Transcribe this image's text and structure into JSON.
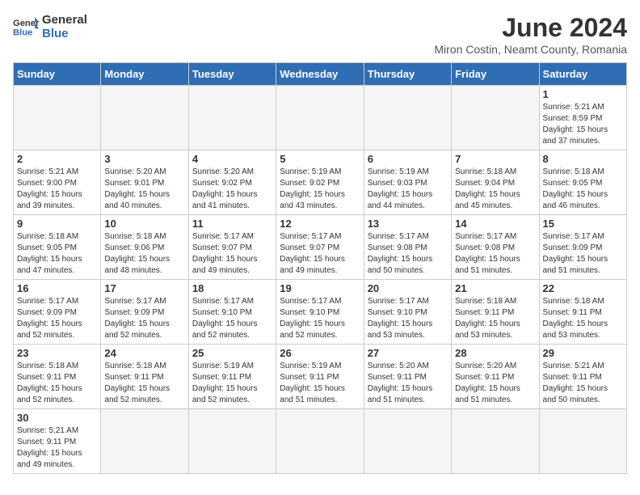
{
  "header": {
    "logo_general": "General",
    "logo_blue": "Blue",
    "title": "June 2024",
    "subtitle": "Miron Costin, Neamt County, Romania"
  },
  "weekdays": [
    "Sunday",
    "Monday",
    "Tuesday",
    "Wednesday",
    "Thursday",
    "Friday",
    "Saturday"
  ],
  "weeks": [
    [
      {
        "day": "",
        "info": ""
      },
      {
        "day": "",
        "info": ""
      },
      {
        "day": "",
        "info": ""
      },
      {
        "day": "",
        "info": ""
      },
      {
        "day": "",
        "info": ""
      },
      {
        "day": "",
        "info": ""
      },
      {
        "day": "1",
        "info": "Sunrise: 5:21 AM\nSunset: 8:59 PM\nDaylight: 15 hours\nand 37 minutes."
      }
    ],
    [
      {
        "day": "2",
        "info": "Sunrise: 5:21 AM\nSunset: 9:00 PM\nDaylight: 15 hours\nand 39 minutes."
      },
      {
        "day": "3",
        "info": "Sunrise: 5:20 AM\nSunset: 9:01 PM\nDaylight: 15 hours\nand 40 minutes."
      },
      {
        "day": "4",
        "info": "Sunrise: 5:20 AM\nSunset: 9:02 PM\nDaylight: 15 hours\nand 41 minutes."
      },
      {
        "day": "5",
        "info": "Sunrise: 5:19 AM\nSunset: 9:02 PM\nDaylight: 15 hours\nand 43 minutes."
      },
      {
        "day": "6",
        "info": "Sunrise: 5:19 AM\nSunset: 9:03 PM\nDaylight: 15 hours\nand 44 minutes."
      },
      {
        "day": "7",
        "info": "Sunrise: 5:18 AM\nSunset: 9:04 PM\nDaylight: 15 hours\nand 45 minutes."
      },
      {
        "day": "8",
        "info": "Sunrise: 5:18 AM\nSunset: 9:05 PM\nDaylight: 15 hours\nand 46 minutes."
      }
    ],
    [
      {
        "day": "9",
        "info": "Sunrise: 5:18 AM\nSunset: 9:05 PM\nDaylight: 15 hours\nand 47 minutes."
      },
      {
        "day": "10",
        "info": "Sunrise: 5:18 AM\nSunset: 9:06 PM\nDaylight: 15 hours\nand 48 minutes."
      },
      {
        "day": "11",
        "info": "Sunrise: 5:17 AM\nSunset: 9:07 PM\nDaylight: 15 hours\nand 49 minutes."
      },
      {
        "day": "12",
        "info": "Sunrise: 5:17 AM\nSunset: 9:07 PM\nDaylight: 15 hours\nand 49 minutes."
      },
      {
        "day": "13",
        "info": "Sunrise: 5:17 AM\nSunset: 9:08 PM\nDaylight: 15 hours\nand 50 minutes."
      },
      {
        "day": "14",
        "info": "Sunrise: 5:17 AM\nSunset: 9:08 PM\nDaylight: 15 hours\nand 51 minutes."
      },
      {
        "day": "15",
        "info": "Sunrise: 5:17 AM\nSunset: 9:09 PM\nDaylight: 15 hours\nand 51 minutes."
      }
    ],
    [
      {
        "day": "16",
        "info": "Sunrise: 5:17 AM\nSunset: 9:09 PM\nDaylight: 15 hours\nand 52 minutes."
      },
      {
        "day": "17",
        "info": "Sunrise: 5:17 AM\nSunset: 9:09 PM\nDaylight: 15 hours\nand 52 minutes."
      },
      {
        "day": "18",
        "info": "Sunrise: 5:17 AM\nSunset: 9:10 PM\nDaylight: 15 hours\nand 52 minutes."
      },
      {
        "day": "19",
        "info": "Sunrise: 5:17 AM\nSunset: 9:10 PM\nDaylight: 15 hours\nand 52 minutes."
      },
      {
        "day": "20",
        "info": "Sunrise: 5:17 AM\nSunset: 9:10 PM\nDaylight: 15 hours\nand 53 minutes."
      },
      {
        "day": "21",
        "info": "Sunrise: 5:18 AM\nSunset: 9:11 PM\nDaylight: 15 hours\nand 53 minutes."
      },
      {
        "day": "22",
        "info": "Sunrise: 5:18 AM\nSunset: 9:11 PM\nDaylight: 15 hours\nand 53 minutes."
      }
    ],
    [
      {
        "day": "23",
        "info": "Sunrise: 5:18 AM\nSunset: 9:11 PM\nDaylight: 15 hours\nand 52 minutes."
      },
      {
        "day": "24",
        "info": "Sunrise: 5:18 AM\nSunset: 9:11 PM\nDaylight: 15 hours\nand 52 minutes."
      },
      {
        "day": "25",
        "info": "Sunrise: 5:19 AM\nSunset: 9:11 PM\nDaylight: 15 hours\nand 52 minutes."
      },
      {
        "day": "26",
        "info": "Sunrise: 5:19 AM\nSunset: 9:11 PM\nDaylight: 15 hours\nand 51 minutes."
      },
      {
        "day": "27",
        "info": "Sunrise: 5:20 AM\nSunset: 9:11 PM\nDaylight: 15 hours\nand 51 minutes."
      },
      {
        "day": "28",
        "info": "Sunrise: 5:20 AM\nSunset: 9:11 PM\nDaylight: 15 hours\nand 51 minutes."
      },
      {
        "day": "29",
        "info": "Sunrise: 5:21 AM\nSunset: 9:11 PM\nDaylight: 15 hours\nand 50 minutes."
      }
    ],
    [
      {
        "day": "30",
        "info": "Sunrise: 5:21 AM\nSunset: 9:11 PM\nDaylight: 15 hours\nand 49 minutes."
      },
      {
        "day": "",
        "info": ""
      },
      {
        "day": "",
        "info": ""
      },
      {
        "day": "",
        "info": ""
      },
      {
        "day": "",
        "info": ""
      },
      {
        "day": "",
        "info": ""
      },
      {
        "day": "",
        "info": ""
      }
    ]
  ]
}
